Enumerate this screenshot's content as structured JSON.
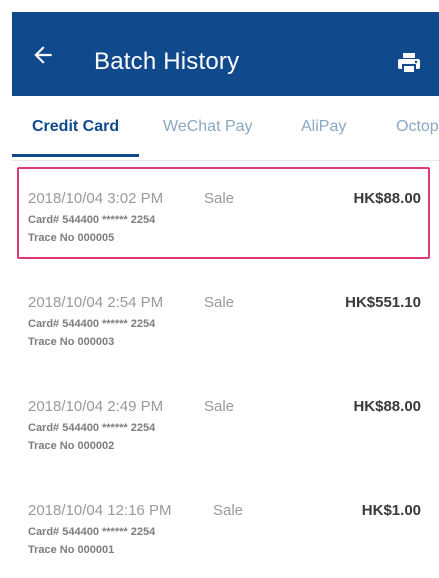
{
  "header": {
    "title": "Batch History",
    "back_icon": "arrow-left-icon",
    "print_icon": "printer-icon",
    "background": "#114a8c"
  },
  "tabs": [
    {
      "label": "Credit Card",
      "active": true
    },
    {
      "label": "WeChat Pay",
      "active": false
    },
    {
      "label": "AliPay",
      "active": false
    },
    {
      "label": "Octop",
      "active": false
    }
  ],
  "transactions": [
    {
      "datetime": "2018/10/04 3:02 PM",
      "type": "Sale",
      "amount": "HK$88.00",
      "card": "Card# 544400 ****** 2254",
      "trace": "Trace No 000005",
      "highlighted": true
    },
    {
      "datetime": "2018/10/04 2:54 PM",
      "type": "Sale",
      "amount": "HK$551.10",
      "card": "Card# 544400 ****** 2254",
      "trace": "Trace No 000003",
      "highlighted": false
    },
    {
      "datetime": "2018/10/04 2:49 PM",
      "type": "Sale",
      "amount": "HK$88.00",
      "card": "Card# 544400 ****** 2254",
      "trace": "Trace No 000002",
      "highlighted": false
    },
    {
      "datetime": "2018/10/04 12:16 PM",
      "type": "Sale",
      "amount": "HK$1.00",
      "card": "Card# 544400 ****** 2254",
      "trace": "Trace No 000001",
      "highlighted": false
    }
  ],
  "colors": {
    "accent": "#114a8c",
    "highlight": "#e0397a"
  }
}
